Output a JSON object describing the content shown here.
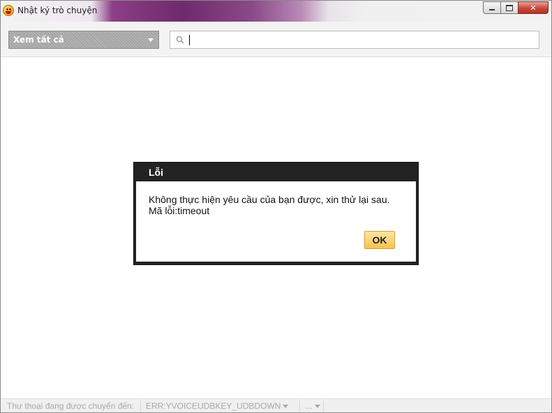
{
  "window": {
    "title": "Nhật ký trò chuyện",
    "icon": "smiley-icon"
  },
  "toolbar": {
    "filter_label": "Xem tất cả",
    "search_value": "",
    "search_icon": "search-icon"
  },
  "dialog": {
    "title": "Lỗi",
    "message_line1": "Không thực hiện yêu cầu của bạn được, xin thử lại sau.",
    "message_line2": "Mã lỗi:timeout",
    "ok_label": "OK"
  },
  "status": {
    "label": "Thư thoại đang được chuyển đến:",
    "key_value": "ERR:YVOICEUDBKEY_UDBDOWN",
    "more_label": "..."
  },
  "colors": {
    "dialog_frame": "#222222",
    "ok_button": "#f6c24e",
    "close_button": "#c6483b"
  }
}
